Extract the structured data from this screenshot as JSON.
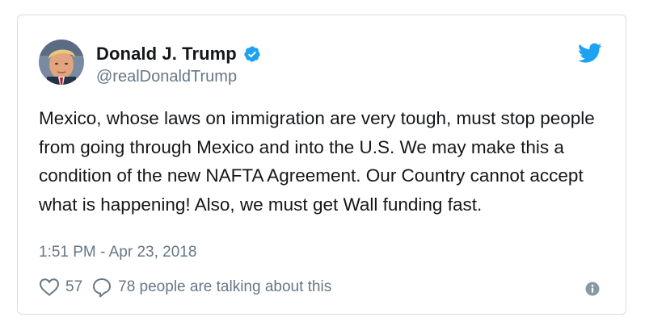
{
  "author": {
    "display_name": "Donald J. Trump",
    "handle": "@realDonaldTrump",
    "verified": true
  },
  "tweet": {
    "text": "Mexico, whose laws on immigration are very tough, must stop people from going through Mexico and into the U.S. We may make this a condition of the new NAFTA Agreement. Our Country cannot accept what is happening! Also, we must get Wall funding fast.",
    "timestamp": "1:51 PM - Apr 23, 2018"
  },
  "engagement": {
    "likes": "57",
    "talking": "78 people are talking about this"
  },
  "icons": {
    "verified": "verified-badge-icon",
    "platform": "twitter-bird-icon",
    "like": "heart-icon",
    "reply": "reply-bubble-icon",
    "info": "info-icon"
  },
  "colors": {
    "brand": "#1da1f2",
    "text": "#14171a",
    "muted": "#657786",
    "border": "#d9dde1"
  }
}
